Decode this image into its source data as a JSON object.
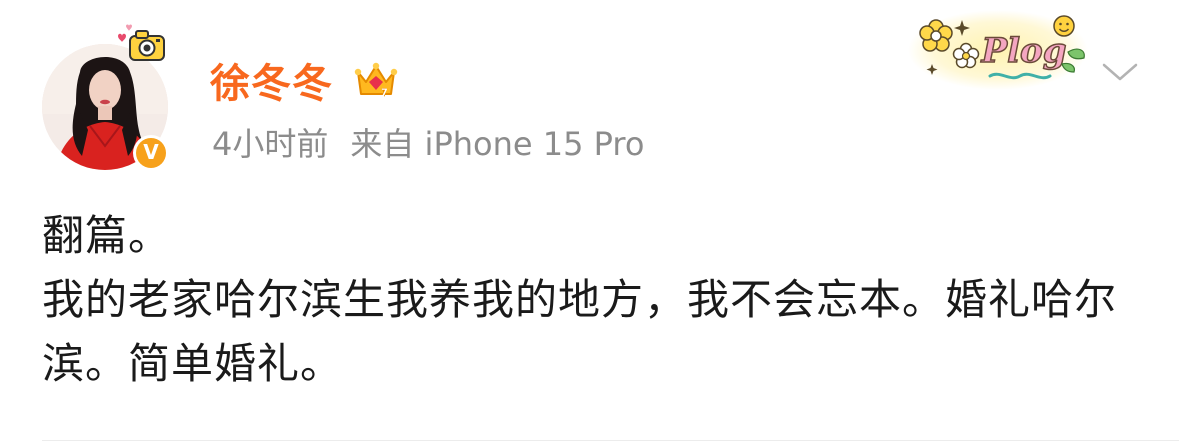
{
  "post": {
    "author": {
      "name": "徐冬冬",
      "verified_badge_letter": "V",
      "verified_color": "#f7a11b",
      "name_color": "#f8681e",
      "member_icon": "crown-icon"
    },
    "meta": {
      "time": "4小时前",
      "source": "来自 iPhone 15 Pro"
    },
    "body_lines": [
      "翻篇。",
      "我的老家哈尔滨生我养我的地方，我不会忘本。婚礼哈尔滨。简单婚礼。"
    ],
    "decorations": {
      "sticker_label": "Plog",
      "camera_sticker": "camera-sticker-icon",
      "menu_icon": "chevron-down-icon"
    }
  }
}
